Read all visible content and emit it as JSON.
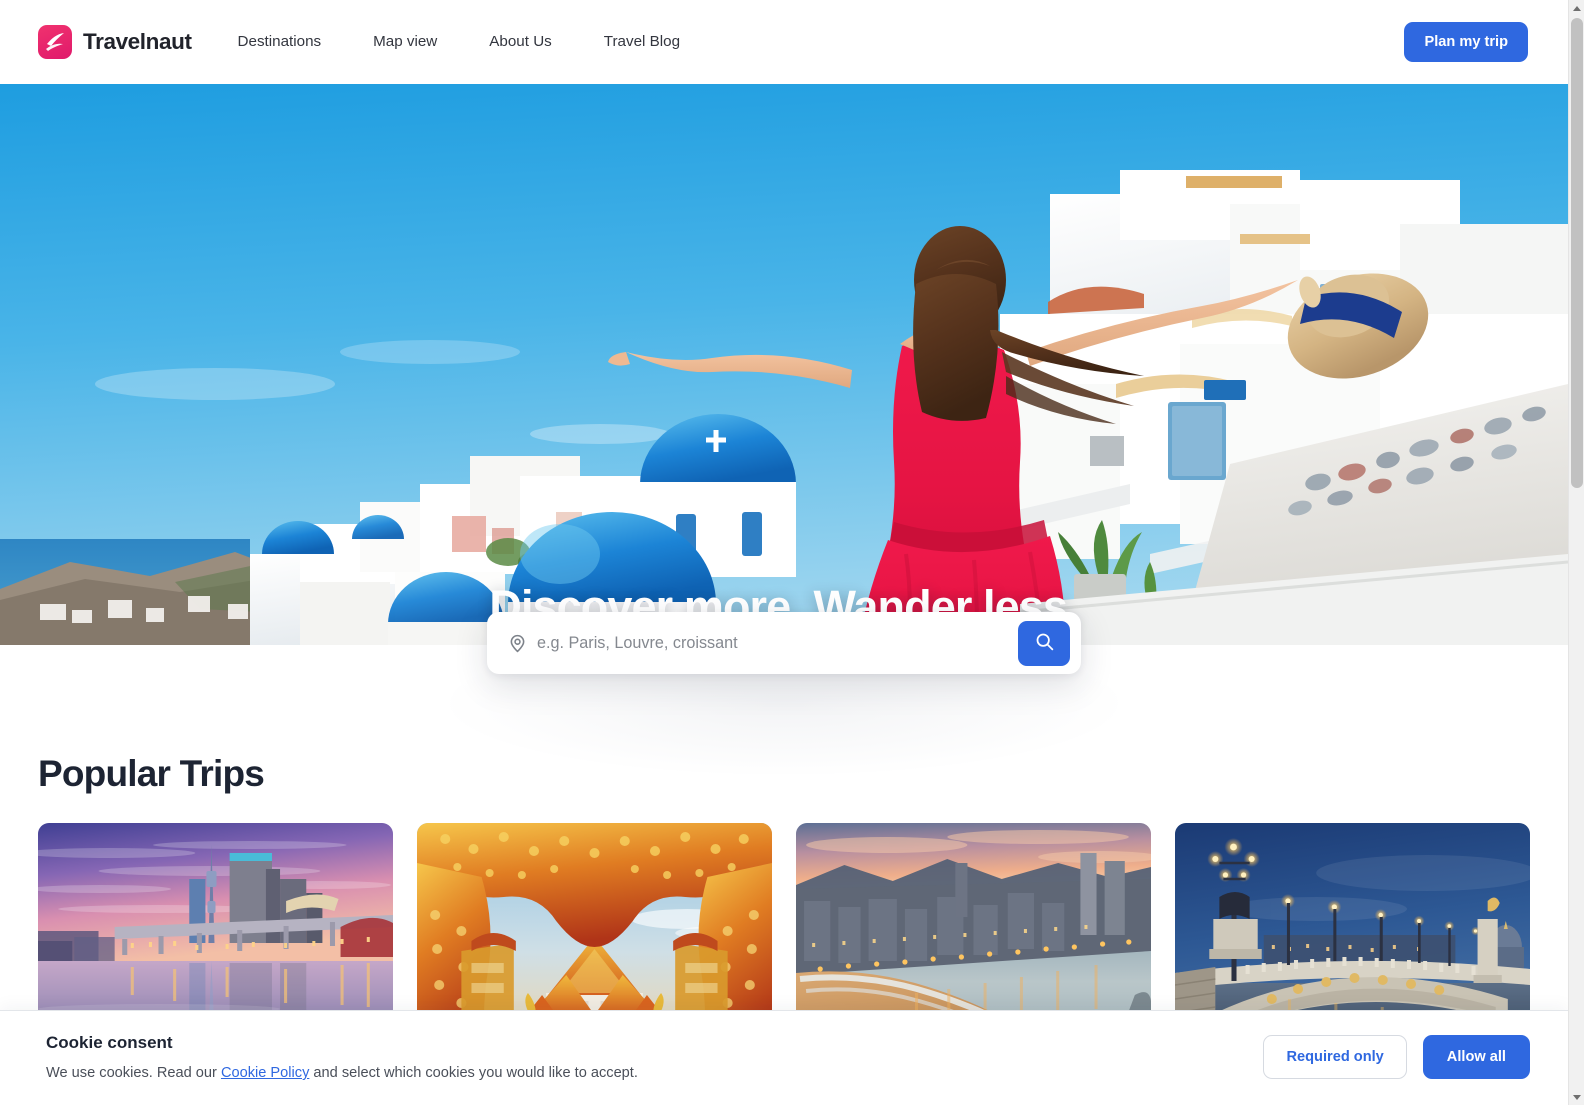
{
  "brand": {
    "name": "Travelnaut",
    "mark_icon": "travelnaut-logo-icon",
    "mark_color": "#e0196b"
  },
  "nav": {
    "items": [
      {
        "label": "Destinations"
      },
      {
        "label": "Map view"
      },
      {
        "label": "About Us"
      },
      {
        "label": "Travel Blog"
      }
    ],
    "cta_label": "Plan my trip",
    "cta_color": "#2f68e0"
  },
  "hero": {
    "title": "Discover more. Wander less.",
    "image_alt": "Woman in red dress with straw hat overlooking whitewashed Santorini village with blue domes"
  },
  "search": {
    "placeholder": "e.g. Paris, Louvre, croissant",
    "value": "",
    "pin_icon": "location-pin-icon",
    "button_icon": "search-icon",
    "button_color": "#2f68e0"
  },
  "popular": {
    "title": "Popular Trips",
    "cards": [
      {
        "alt": "Tokyo skyline at sunset with Skytree reflected in the river"
      },
      {
        "alt": "Bangkok marble temple framed by ornate golden red archway"
      },
      {
        "alt": "Barcelona beachfront and city lights at dusk"
      },
      {
        "alt": "Paris Pont Alexandre III bridge lit at blue hour"
      }
    ]
  },
  "cookie": {
    "title": "Cookie consent",
    "body_before": "We use cookies. Read our ",
    "link_label": "Cookie Policy",
    "body_after": " and select which cookies you would like to accept.",
    "required_label": "Required only",
    "allow_label": "Allow all"
  },
  "scrollbar": {
    "up_icon": "scroll-up-arrow-icon",
    "down_icon": "scroll-down-arrow-icon"
  }
}
